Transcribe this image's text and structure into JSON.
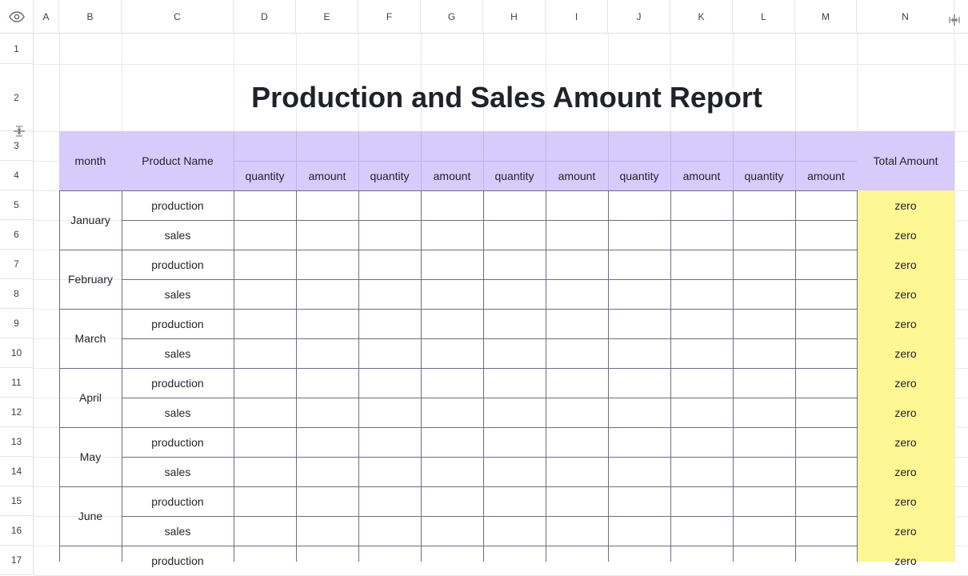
{
  "sheet": {
    "columns": [
      "A",
      "B",
      "C",
      "D",
      "E",
      "F",
      "G",
      "H",
      "I",
      "J",
      "K",
      "L",
      "M",
      "N"
    ],
    "rows": [
      "1",
      "2",
      "3",
      "4",
      "5",
      "6",
      "7",
      "8",
      "9",
      "10",
      "11",
      "12",
      "13",
      "14",
      "15",
      "16",
      "17"
    ]
  },
  "report": {
    "title": "Production and Sales Amount Report",
    "headers": {
      "month": "month",
      "product_name": "Product Name",
      "total_amount": "Total Amount",
      "sub": [
        "quantity",
        "amount",
        "quantity",
        "amount",
        "quantity",
        "amount",
        "quantity",
        "amount",
        "quantity",
        "amount"
      ]
    },
    "months": [
      "January",
      "February",
      "March",
      "April",
      "May",
      "June"
    ],
    "row_labels": [
      "production",
      "sales",
      "production",
      "sales",
      "production",
      "sales",
      "production",
      "sales",
      "production",
      "sales",
      "production",
      "sales",
      "production"
    ],
    "totals": [
      "zero",
      "zero",
      "zero",
      "zero",
      "zero",
      "zero",
      "zero",
      "zero",
      "zero",
      "zero",
      "zero",
      "zero",
      "zero"
    ]
  },
  "icons": {
    "visibility": "eye-icon",
    "freeze_col": "freeze-column-icon",
    "freeze_row": "freeze-row-icon"
  },
  "colors": {
    "header_fill": "#d7cbfc",
    "total_fill": "#fff694",
    "border": "#6a6d85"
  }
}
